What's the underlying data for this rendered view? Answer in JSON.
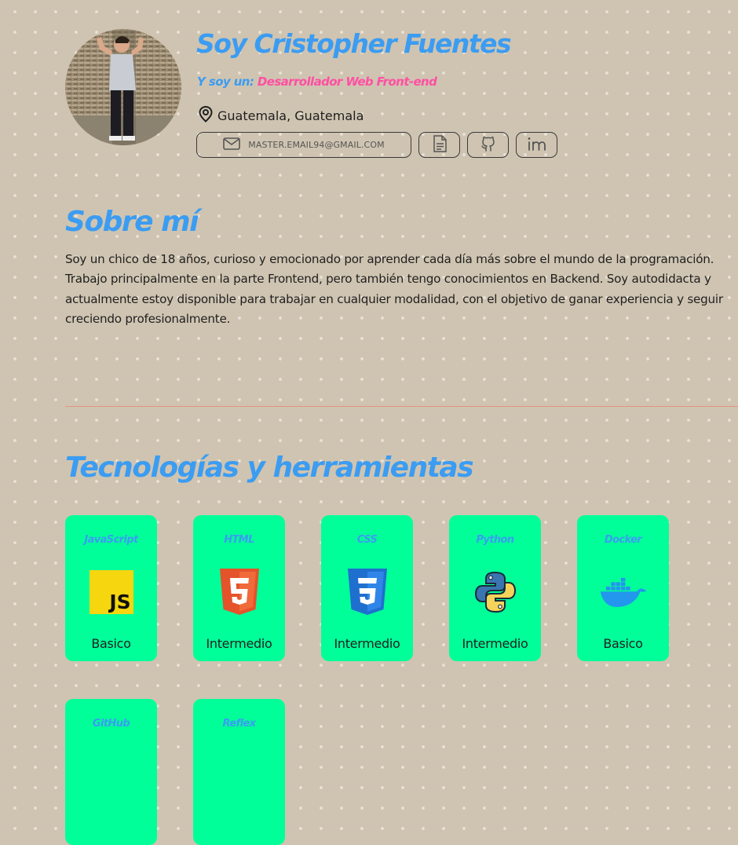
{
  "profile": {
    "name": "Soy Cristopher Fuentes",
    "role_label": "Y soy un:",
    "role_value": "Desarrollador Web Front-end",
    "location": "Guatemala, Guatemala",
    "email": "MASTER.EMAIL94@GMAIL.COM"
  },
  "about": {
    "heading": "Sobre mí",
    "text": "Soy un chico de 18 años, curioso y emocionado por aprender cada día más sobre el mundo de la programación. Trabajo principalmente en la parte Frontend, pero también tengo conocimientos en Backend. Soy autodidacta y actualmente estoy disponible para trabajar en cualquier modalidad, con el objetivo de ganar experiencia y seguir creciendo profesionalmente."
  },
  "tech": {
    "heading": "Tecnologías y herramientas",
    "items": [
      {
        "name": "JavaScript",
        "level": "Basico",
        "icon": "javascript-icon"
      },
      {
        "name": "HTML",
        "level": "Intermedio",
        "icon": "html5-icon"
      },
      {
        "name": "CSS",
        "level": "Intermedio",
        "icon": "css3-icon"
      },
      {
        "name": "Python",
        "level": "Intermedio",
        "icon": "python-icon"
      },
      {
        "name": "Docker",
        "level": "Basico",
        "icon": "docker-icon"
      },
      {
        "name": "GitHub",
        "level": "",
        "icon": "github-icon"
      },
      {
        "name": "Reflex",
        "level": "",
        "icon": "reflex-icon"
      }
    ]
  },
  "colors": {
    "background": "#cfc4b1",
    "accent_blue": "#3b9cf2",
    "accent_pink": "#ff4fa3",
    "card_green": "#00ff99",
    "divider": "#e0967c"
  }
}
